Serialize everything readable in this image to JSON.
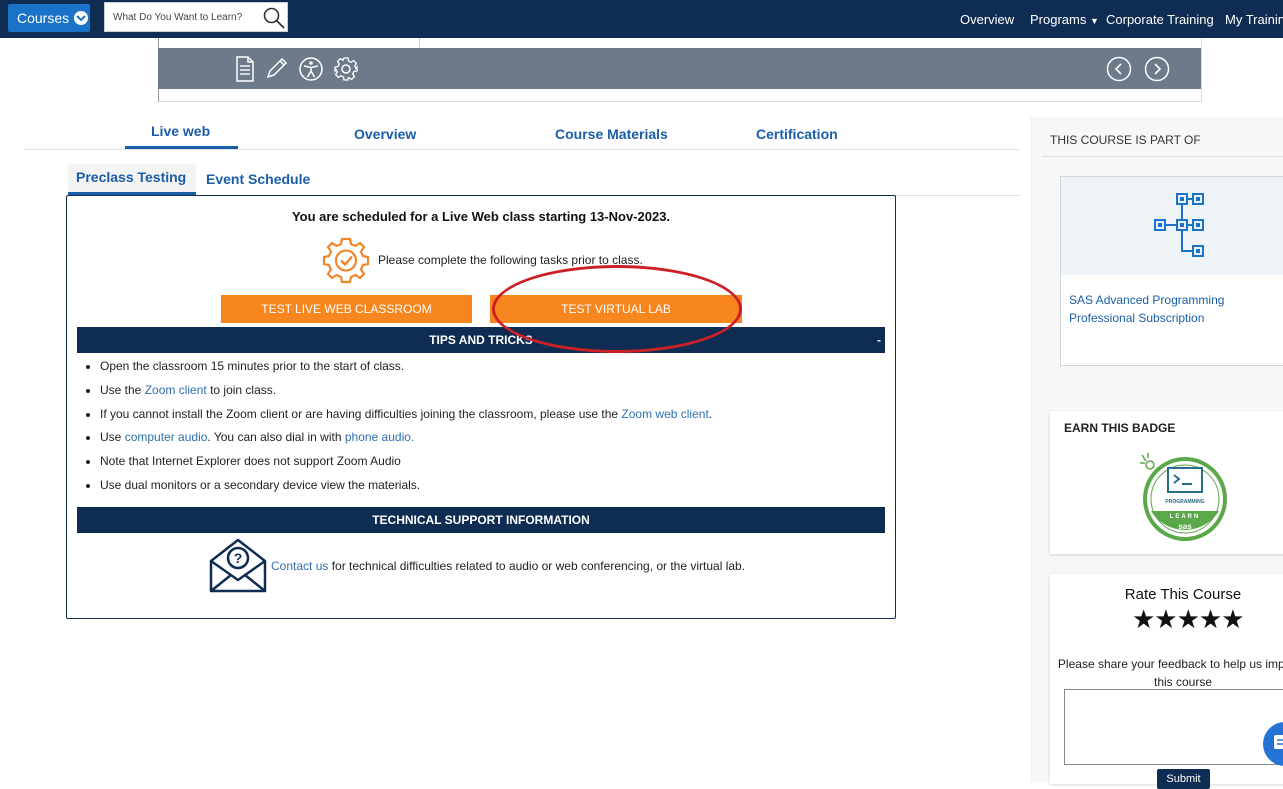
{
  "topbar": {
    "courses_label": "Courses",
    "search_placeholder": "What Do You Want to Learn?",
    "nav": [
      "Overview",
      "Programs",
      "Corporate Training",
      "My Training"
    ]
  },
  "tabs": {
    "main": [
      "Live web",
      "Overview",
      "Course Materials",
      "Certification"
    ],
    "sub": [
      "Preclass Testing",
      "Event Schedule"
    ]
  },
  "content": {
    "scheduled": "You are scheduled for a Live Web class starting 13-Nov-2023.",
    "tasks": "Please complete the following tasks prior to class.",
    "btn_classroom": "TEST LIVE WEB CLASSROOM",
    "btn_lab": "TEST VIRTUAL LAB",
    "tips_header": "TIPS AND TRICKS",
    "tips_collapse": "-",
    "tips": {
      "t1": "Open the classroom 15 minutes prior to the start of class.",
      "t2_pre": "Use the ",
      "t2_link": "Zoom client",
      "t2_post": " to join class.",
      "t3_pre": "If you cannot install the Zoom client or are having difficulties joining the classroom, please use the ",
      "t3_link": "Zoom web client",
      "t3_post": ".",
      "t4_pre": "Use ",
      "t4_link1": "computer audio",
      "t4_mid": ". You can also dial in with ",
      "t4_link2": "phone audio.",
      "t5": "Note that Internet Explorer does not support Zoom Audio",
      "t6": "Use dual monitors or a secondary device view the materials."
    },
    "support_header": "TECHNICAL SUPPORT INFORMATION",
    "support_link": "Contact us",
    "support_text": " for technical difficulties related to audio or web conferencing, or the virtual lab."
  },
  "sidebar": {
    "part_of_title": "THIS COURSE IS PART OF",
    "card_title": "SAS Advanced Programming Professional Subscription",
    "badge_title": "EARN THIS BADGE",
    "badge_text_top": "PROGRAMMING",
    "badge_text_mid": "LEARN",
    "badge_text_brand": "sas",
    "rate_title": "Rate This Course",
    "stars": "★★★★★",
    "feedback": "Please share your feedback to help us improve this course",
    "submit": "Submit"
  },
  "colors": {
    "navy": "#0f2d52",
    "blue": "#1a5ea8",
    "orange": "#f7861e",
    "annotation_red": "#cc2027",
    "badge_green": "#4caf50"
  }
}
